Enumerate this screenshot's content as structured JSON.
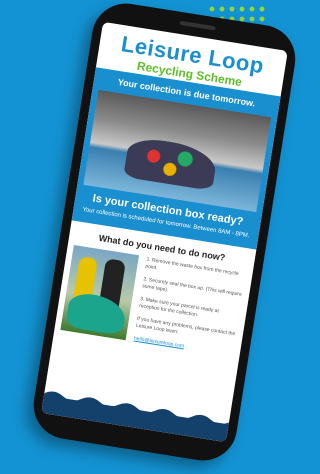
{
  "logo": {
    "title": "Leisure Loop",
    "subtitle": "Recycling Scheme"
  },
  "banner": {
    "title": "Your collection is due tomorrow.",
    "cta_title": "Is your collection box ready?",
    "cta_text": "Your collection is scheduled for tomorrow. Between 8AM - 8PM."
  },
  "section": {
    "title": "What do you need to do now?"
  },
  "steps": [
    "1. Remove the waste box from the recycle point.",
    "2. Securely seal the box up. (This will require some tape).",
    "3. Make sure your parcel is ready at reception for the collection.",
    "If you have any problems, please contact the Leisure Loop team:",
    "hello@leisureloop.com"
  ],
  "colors": {
    "background": "#1393d3",
    "brand_blue": "#1a8fd0",
    "brand_green": "#5cbf2a"
  }
}
